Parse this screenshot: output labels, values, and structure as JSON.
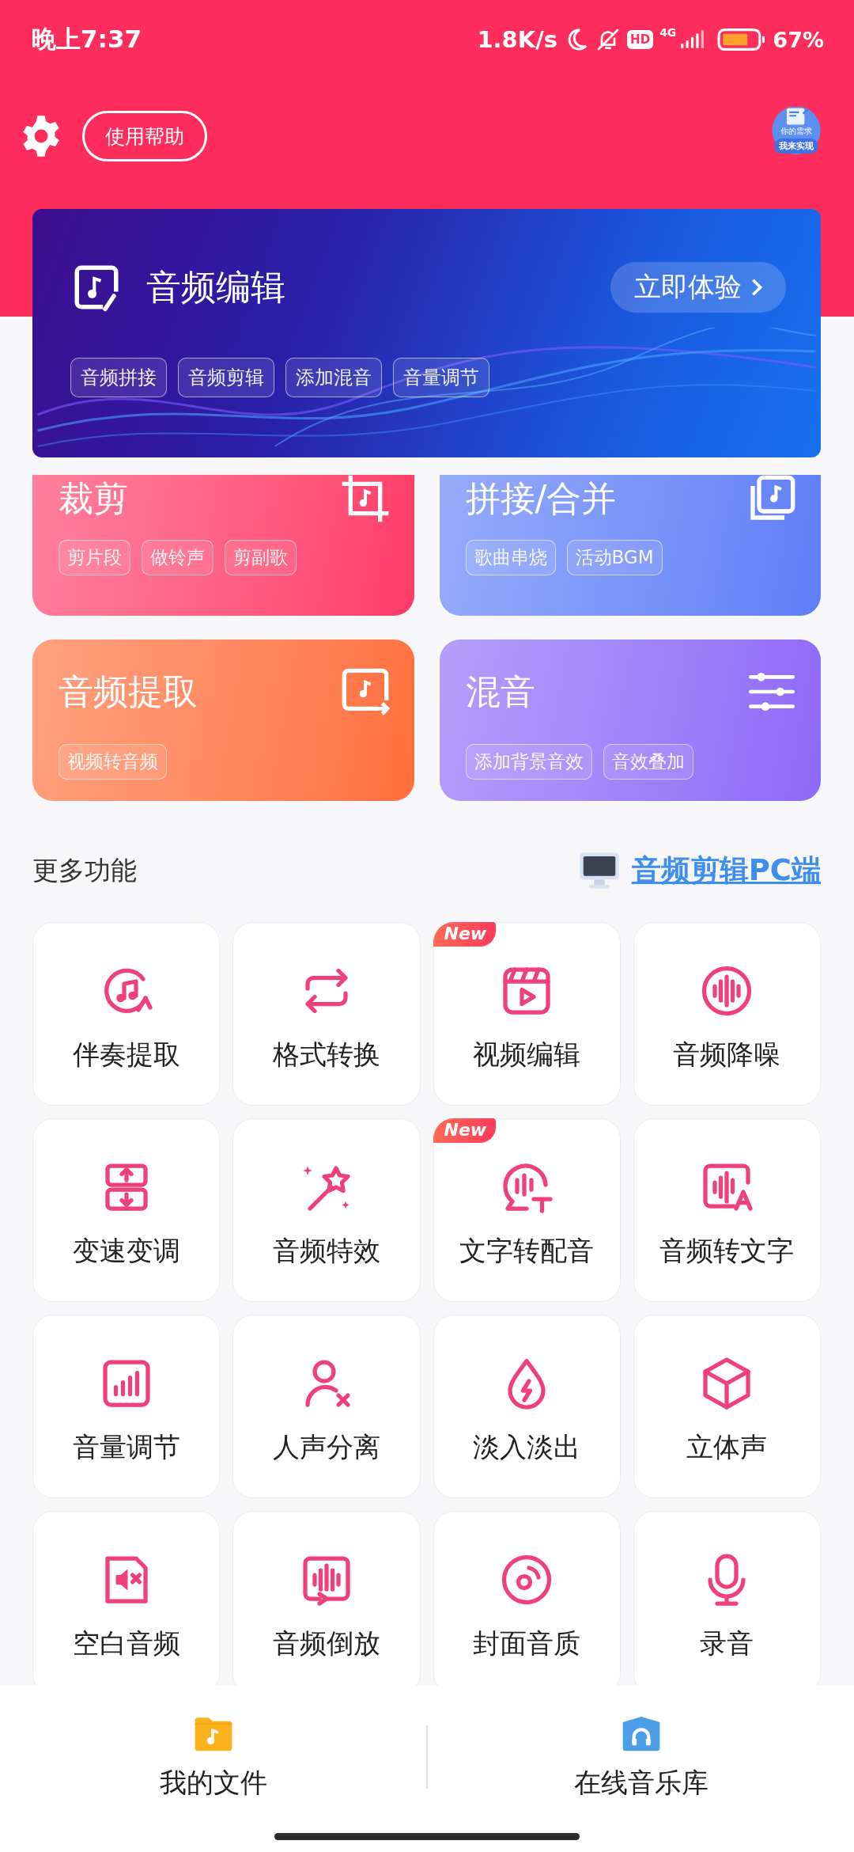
{
  "status_bar": {
    "time": "晚上7:37",
    "speed": "1.8K/s",
    "hd": "HD",
    "network": "4G",
    "battery": "67%"
  },
  "toolbar": {
    "help_button": "使用帮助",
    "request_badge": {
      "caption": "你的需求",
      "label": "我来实现"
    }
  },
  "banner": {
    "title": "音频编辑",
    "action": "立即体验",
    "tags": [
      "音频拼接",
      "音频剪辑",
      "添加混音",
      "音量调节"
    ]
  },
  "feature_cards": [
    {
      "title": "裁剪",
      "color": "#ff3a68",
      "tags": [
        "剪片段",
        "做铃声",
        "剪副歌"
      ]
    },
    {
      "title": "拼接/合并",
      "color": "#5f7ef8",
      "tags": [
        "歌曲串烧",
        "活动BGM"
      ]
    },
    {
      "title": "音频提取",
      "color": "#ff6f3c",
      "tags": [
        "视频转音频"
      ]
    },
    {
      "title": "混音",
      "color": "#8f68f8",
      "tags": [
        "添加背景音效",
        "音效叠加"
      ]
    }
  ],
  "more": {
    "title": "更多功能",
    "pc_link": "音频剪辑PC端"
  },
  "tools": [
    {
      "label": "伴奏提取"
    },
    {
      "label": "格式转换"
    },
    {
      "label": "视频编辑",
      "badge": "New"
    },
    {
      "label": "音频降噪"
    },
    {
      "label": "变速变调"
    },
    {
      "label": "音频特效"
    },
    {
      "label": "文字转配音",
      "badge": "New"
    },
    {
      "label": "音频转文字"
    },
    {
      "label": "音量调节"
    },
    {
      "label": "人声分离"
    },
    {
      "label": "淡入淡出"
    },
    {
      "label": "立体声"
    },
    {
      "label": "空白音频"
    },
    {
      "label": "音频倒放"
    },
    {
      "label": "封面音质"
    },
    {
      "label": "录音"
    }
  ],
  "bottom_nav": [
    {
      "label": "我的文件"
    },
    {
      "label": "在线音乐库"
    }
  ]
}
